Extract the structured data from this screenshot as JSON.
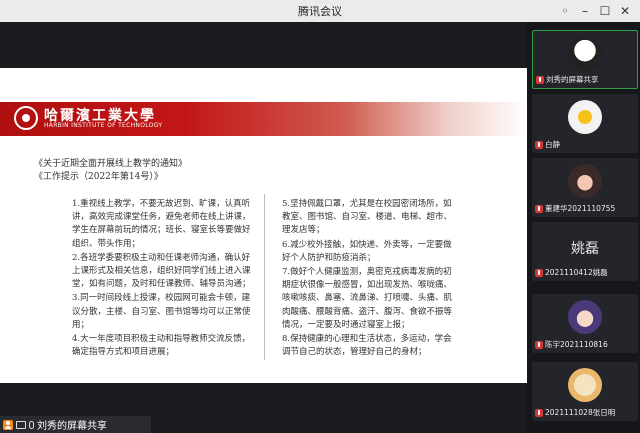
{
  "window": {
    "title": "腾讯会议"
  },
  "slide": {
    "logo_cn": "哈爾濱工業大學",
    "logo_en": "HARBIN INSTITUTE OF TECHNOLOGY",
    "notice_line1": "《关于近期全面开展线上教学的通知》",
    "notice_line2": "《工作提示（2022年第14号）》",
    "left_items": [
      "1.重视线上教学，不要无故迟到、旷课，认真听讲，高效完成课堂任务，避免老师在线上讲课，学生在屏幕前玩的情况；班长、寝室长等要做好组织、带头作用；",
      "2.各班学委要积极主动和任课老师沟通，确认好上课形式及相关信息，组织好同学们线上进入课堂，如有问题，及时和任课教师、辅导员沟通；",
      "3.同一时间段线上授课，校园网可能会卡顿，建议分散，主楼、自习室、图书馆等均可以正常使用；",
      "4.大一年度项目积极主动和指导教师交流反馈，确定指导方式和项目进展；"
    ],
    "right_items": [
      "5.坚持佩戴口罩，尤其是在校园密闭场所，如教室、图书馆、自习室、楼道、电梯、超市、理发店等；",
      "6.减少校外接触，如快递、外卖等，一定要做好个人防护和防疫消杀；",
      "7.做好个人健康监测，奥密克戎病毒发病的初期症状很像一般感冒，如出现发热、喉咙痛、咳嗽咳痰、鼻塞、流鼻涕、打喷嚏、头痛、肌肉酸痛、腰酸背痛、盗汗、腹泻、食欲不振等情况，一定要及时通过寝室上报；",
      "8.保持健康的心理和生活状态，多运动，学会调节自己的状态，管理好自己的身材；"
    ]
  },
  "share_tag": {
    "label": "刘秀的屏幕共享"
  },
  "participants": [
    {
      "name": "刘秀的屏幕共享",
      "avatar": "anime-avatar",
      "active": true
    },
    {
      "name": "白静",
      "avatar": "sun-avatar",
      "active": false
    },
    {
      "name": "董建华2021110755",
      "avatar": "girl-avatar",
      "active": false
    },
    {
      "name": "2021110412姚磊",
      "avatar": "text-avatar",
      "display_text": "姚磊",
      "active": false
    },
    {
      "name": "陈宇2021110816",
      "avatar": "boy-avatar",
      "active": false
    },
    {
      "name": "2021111028张日明",
      "avatar": "cat-avatar",
      "active": false
    }
  ]
}
